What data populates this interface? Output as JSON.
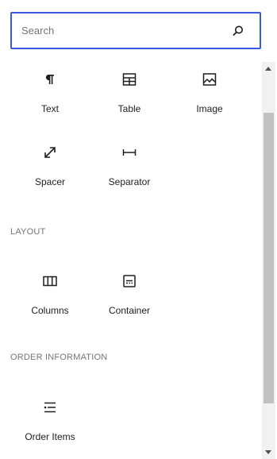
{
  "search": {
    "placeholder": "Search",
    "value": ""
  },
  "sections": {
    "text": {
      "items": [
        {
          "label": "Text",
          "icon": "paragraph-icon"
        },
        {
          "label": "Table",
          "icon": "table-icon"
        },
        {
          "label": "Image",
          "icon": "image-icon"
        },
        {
          "label": "Spacer",
          "icon": "resize-diagonal-icon"
        },
        {
          "label": "Separator",
          "icon": "separator-icon"
        }
      ]
    },
    "layout": {
      "title": "LAYOUT",
      "items": [
        {
          "label": "Columns",
          "icon": "columns-icon"
        },
        {
          "label": "Container",
          "icon": "container-icon"
        }
      ]
    },
    "order_information": {
      "title": "ORDER INFORMATION",
      "items": [
        {
          "label": "Order Items",
          "icon": "order-items-icon"
        }
      ]
    }
  },
  "colors": {
    "accent": "#3858e9",
    "text": "#1e1e1e",
    "muted": "#757575"
  }
}
